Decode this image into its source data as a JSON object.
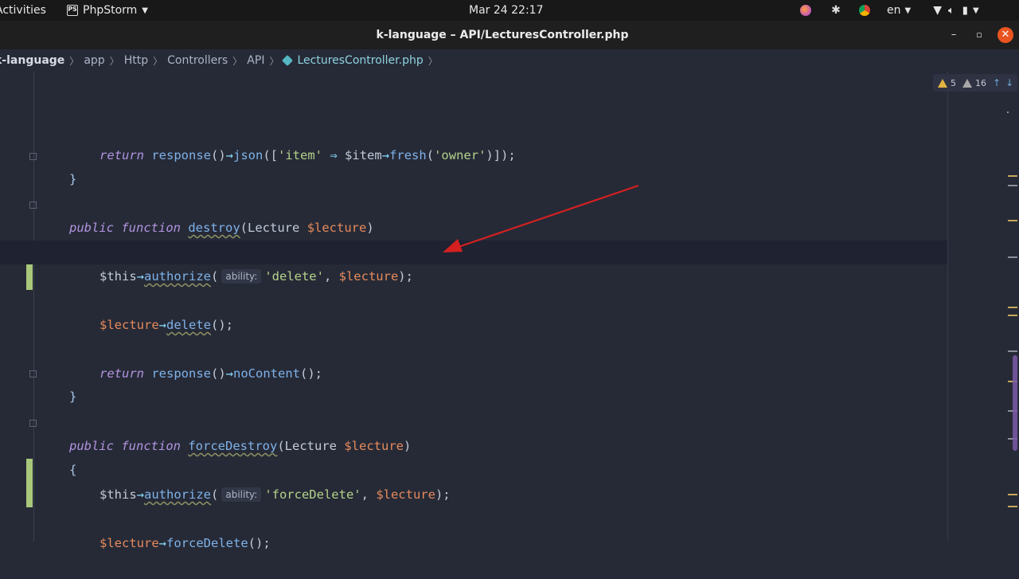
{
  "topbar": {
    "activities": "Activities",
    "app_name": "PhpStorm",
    "clock": "Mar 24  22:17",
    "lang": "en"
  },
  "window": {
    "title": "k-language – API/LecturesController.php"
  },
  "breadcrumb": [
    "k-language",
    "app",
    "Http",
    "Controllers",
    "API",
    "LecturesController.php"
  ],
  "inspections": {
    "warnings": "5",
    "weak_warnings": "16"
  },
  "code": {
    "l1_return": "return",
    "l1_response": "response",
    "l1_json": "json",
    "l1_item_str": "'item'",
    "l1_item_var": "$item",
    "l1_fresh": "fresh",
    "l1_owner": "'owner'",
    "public": "public",
    "function": "function",
    "destroy": "destroy",
    "lecture_type": "Lecture",
    "lecture_var": "$lecture",
    "this": "$this",
    "authorize": "authorize",
    "hint_ability": "ability:",
    "delete_str": "'delete'",
    "delete_fn": "delete",
    "noContent": "noContent",
    "forceDestroy": "forceDestroy",
    "forceDelete_str": "'forceDelete'",
    "forceDelete_fn": "forceDelete"
  },
  "colors": {
    "accent_close": "#e95420",
    "change_marker": "#a8c77a",
    "annotation_arrow": "#d42020"
  }
}
